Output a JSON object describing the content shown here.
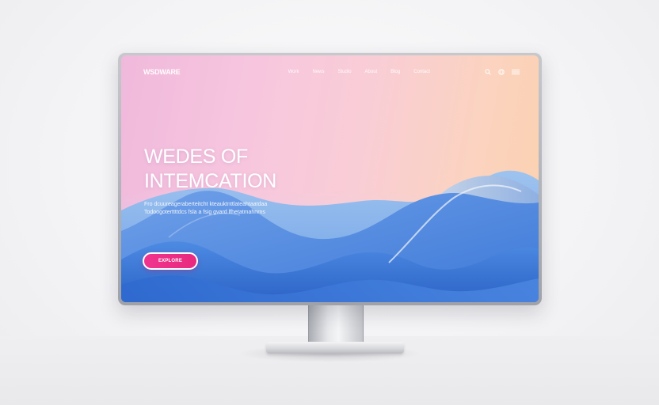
{
  "site": {
    "logo": "WSDWARE",
    "nav_links": [
      "Work",
      "News",
      "Studio",
      "About",
      "Blog",
      "Contact"
    ],
    "icons": [
      "search-icon",
      "globe-icon",
      "menu-icon"
    ]
  },
  "hero": {
    "title_line1": "WEDES OF",
    "title_line2": "INTEMCATION",
    "subtitle_line1": "Fro dcuureageraberteitcht kteauktnttlateahtaatdaa",
    "subtitle_line2": "Todoogoterttttdcs fsla a fsig gvard lfhetatmahnrns",
    "cta_label": "EXPLORE"
  },
  "colors": {
    "accent": "#e8297f",
    "wave_blue": "#3c7fe0",
    "gradient_pink": "#f3bde0",
    "gradient_peach": "#fbd2ae"
  }
}
